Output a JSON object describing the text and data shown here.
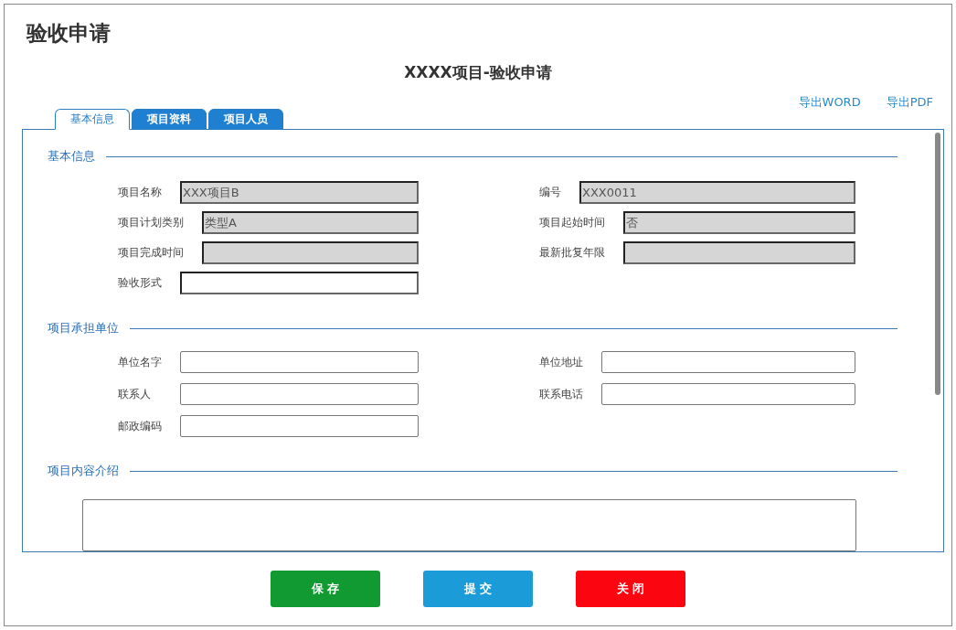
{
  "page_title": "验收申请",
  "form_title": "XXXX项目-验收申请",
  "export_links": [
    "导出WORD",
    "导出PDF"
  ],
  "tabs": [
    {
      "label": "基本信息",
      "selected": true
    },
    {
      "label": "项目资料",
      "selected": false
    },
    {
      "label": "项目人员",
      "selected": false
    }
  ],
  "sections": [
    {
      "kind": "fields",
      "title": "基本信息",
      "columns": [
        [
          {
            "label": "项目名称",
            "value": "XXX项目B",
            "disabled": true
          },
          {
            "label": "项目计划类别",
            "value": "类型A",
            "disabled": true
          },
          {
            "label": "项目完成时间",
            "disabled": true
          },
          {
            "label": "验收形式",
            "disabled": false
          }
        ],
        [
          {
            "label": "编号",
            "value": "XXX0011",
            "disabled": true
          },
          {
            "label": "项目起始时间",
            "value": "否",
            "disabled": true
          },
          {
            "label": "最新批复年限",
            "disabled": true
          }
        ]
      ]
    },
    {
      "kind": "aligned-fields",
      "title": "项目承担单位",
      "columns": [
        [
          {
            "label": "单位名字",
            "disabled": false
          },
          {
            "label": "联系人",
            "disabled": false
          },
          {
            "label": "邮政编码",
            "disabled": false
          }
        ],
        [
          {
            "label": "单位地址",
            "disabled": false
          },
          {
            "label": "联系电话",
            "disabled": false
          }
        ]
      ]
    },
    {
      "kind": "textarea",
      "title": "项目内容介绍"
    }
  ],
  "buttons": [
    {
      "label": "保 存",
      "color": "#129a32"
    },
    {
      "label": "提 交",
      "color": "#1b9bd7"
    },
    {
      "label": "关 闭",
      "color": "#fb0511"
    }
  ]
}
